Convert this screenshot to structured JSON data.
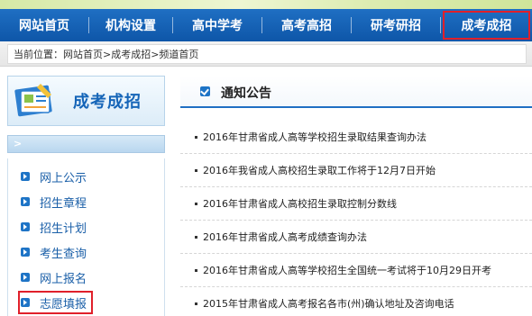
{
  "nav": {
    "items": [
      {
        "label": "网站首页",
        "highlight": false
      },
      {
        "label": "机构设置",
        "highlight": false
      },
      {
        "label": "高中学考",
        "highlight": false
      },
      {
        "label": "高考高招",
        "highlight": false
      },
      {
        "label": "研考研招",
        "highlight": false
      },
      {
        "label": "成考成招",
        "highlight": true
      }
    ]
  },
  "breadcrumb": {
    "text": "当前位置：网站首页>成考成招>频道首页"
  },
  "sidebar": {
    "title": "成考成招",
    "items": [
      {
        "label": "网上公示",
        "highlight": false
      },
      {
        "label": "招生章程",
        "highlight": false
      },
      {
        "label": "招生计划",
        "highlight": false
      },
      {
        "label": "考生查询",
        "highlight": false
      },
      {
        "label": "网上报名",
        "highlight": false
      },
      {
        "label": "志愿填报",
        "highlight": true
      }
    ]
  },
  "main": {
    "section_title": "通知公告",
    "news": [
      "2016年甘肃省成人高等学校招生录取结果查询办法",
      "2016年我省成人高校招生录取工作将于12月7日开始",
      "2016年甘肃省成人高校招生录取控制分数线",
      "2016年甘肃省成人高考成绩查询办法",
      "2016年甘肃省成人高等学校招生全国统一考试将于10月29日开考",
      "2015年甘肃省成人高考报名各市(州)确认地址及咨询电话"
    ]
  },
  "colors": {
    "nav_blue": "#1f6fc3",
    "link_blue": "#1a5fa8",
    "highlight_red": "#e0202a"
  },
  "icons": {
    "sidebar_logo": "certificate-card-icon",
    "list_bullet": "arrow-square-icon",
    "section_marker": "checkbox-icon"
  }
}
